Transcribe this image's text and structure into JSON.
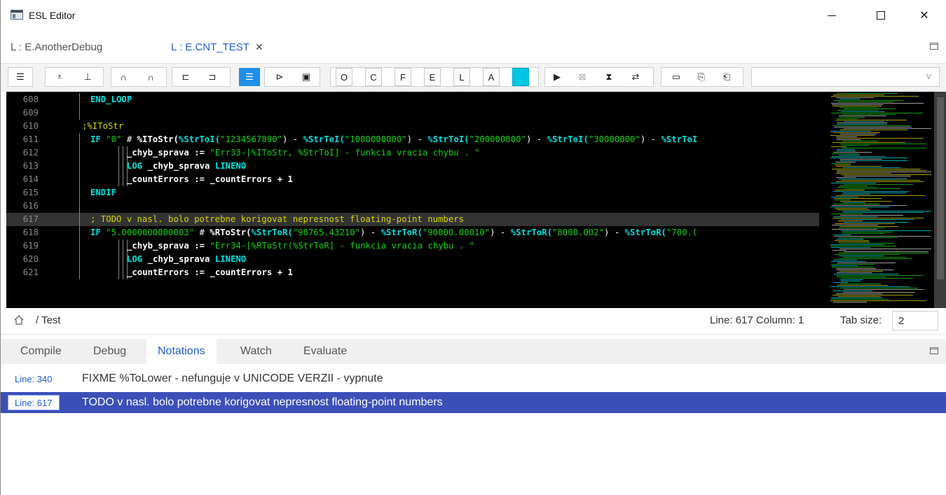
{
  "window": {
    "title": "ESL Editor"
  },
  "file_tabs": [
    {
      "label": "L : E.AnotherDebug",
      "active": false
    },
    {
      "label": "L : E.CNT_TEST",
      "active": true,
      "close": "✕"
    }
  ],
  "toolbar": {
    "icons": [
      "indent-icon",
      "check-icon",
      "cursor-down-icon",
      "undo-icon",
      "redo-icon",
      "bracket-left-icon",
      "bracket-right-icon",
      "list-icon",
      "open-folder-icon",
      "save-icon",
      "o-icon",
      "c-icon",
      "f-icon",
      "e-icon",
      "l-icon",
      "a-icon",
      "square-icon",
      "play-icon",
      "stop-icon",
      "hourglass-icon",
      "swap-icon",
      "window-icon",
      "clipboard-icon",
      "paste-icon"
    ],
    "labels": {
      "o": "O",
      "c": "C",
      "f": "F",
      "e": "E",
      "l": "L",
      "a": "A"
    },
    "combo_value": ""
  },
  "editor": {
    "highlight_color": "#333333",
    "lines": [
      {
        "n": "608",
        "indent": 1,
        "tokens": [
          {
            "t": "END_LOOP",
            "c": "#00e0e0"
          }
        ]
      },
      {
        "n": "609",
        "indent": 1,
        "tokens": []
      },
      {
        "n": "610",
        "indent": 0,
        "tokens": [
          {
            "t": ";%IToStr",
            "c": "#d6d600"
          }
        ]
      },
      {
        "n": "611",
        "indent": 1,
        "tokens": [
          {
            "t": "IF ",
            "c": "#00e0e0"
          },
          {
            "t": "\"0\"",
            "c": "#14d414"
          },
          {
            "t": " # ",
            "c": "#ffffff"
          },
          {
            "t": "%IToStr(",
            "c": "#ffffff"
          },
          {
            "t": "%StrToI(",
            "c": "#00e0e0"
          },
          {
            "t": "\"1234567890\"",
            "c": "#14d414"
          },
          {
            "t": ") - ",
            "c": "#ffffff"
          },
          {
            "t": "%StrToI(",
            "c": "#00e0e0"
          },
          {
            "t": "\"1000000000\"",
            "c": "#14d414"
          },
          {
            "t": ") - ",
            "c": "#ffffff"
          },
          {
            "t": "%StrToI(",
            "c": "#00e0e0"
          },
          {
            "t": "\"200000000\"",
            "c": "#14d414"
          },
          {
            "t": ") - ",
            "c": "#ffffff"
          },
          {
            "t": "%StrToI(",
            "c": "#00e0e0"
          },
          {
            "t": "\"30000000\"",
            "c": "#14d414"
          },
          {
            "t": ") - ",
            "c": "#ffffff"
          },
          {
            "t": "%StrToI",
            "c": "#00e0e0"
          }
        ]
      },
      {
        "n": "612",
        "indent": 4,
        "tokens": [
          {
            "t": "_chyb_sprava := ",
            "c": "#ffffff"
          },
          {
            "t": "\"Err33-[%IToStr, %StrToI] - funkcia vracia chybu . \"",
            "c": "#14d414"
          }
        ]
      },
      {
        "n": "613",
        "indent": 4,
        "tokens": [
          {
            "t": "LOG ",
            "c": "#00e0e0"
          },
          {
            "t": "_chyb_sprava ",
            "c": "#ffffff"
          },
          {
            "t": "LINENO",
            "c": "#00e0e0"
          }
        ]
      },
      {
        "n": "614",
        "indent": 4,
        "tokens": [
          {
            "t": "_countErrors := _countErrors + 1",
            "c": "#ffffff"
          }
        ]
      },
      {
        "n": "615",
        "indent": 1,
        "tokens": [
          {
            "t": "ENDIF",
            "c": "#00e0e0"
          }
        ]
      },
      {
        "n": "616",
        "indent": 1,
        "tokens": []
      },
      {
        "n": "617",
        "indent": 1,
        "highlight": true,
        "tokens": [
          {
            "t": "; TODO v nasl. bolo potrebne korigovat nepresnost floating-point numbers",
            "c": "#d6d600"
          }
        ]
      },
      {
        "n": "618",
        "indent": 1,
        "tokens": [
          {
            "t": "IF ",
            "c": "#00e0e0"
          },
          {
            "t": "\"5.0000000000003\"",
            "c": "#14d414"
          },
          {
            "t": " # ",
            "c": "#ffffff"
          },
          {
            "t": "%RToStr(",
            "c": "#ffffff"
          },
          {
            "t": "%StrToR(",
            "c": "#00e0e0"
          },
          {
            "t": "\"98765.43210\"",
            "c": "#14d414"
          },
          {
            "t": ") - ",
            "c": "#ffffff"
          },
          {
            "t": "%StrToR(",
            "c": "#00e0e0"
          },
          {
            "t": "\"90000.00010\"",
            "c": "#14d414"
          },
          {
            "t": ") - ",
            "c": "#ffffff"
          },
          {
            "t": "%StrToR(",
            "c": "#00e0e0"
          },
          {
            "t": "\"8000.002\"",
            "c": "#14d414"
          },
          {
            "t": ") - ",
            "c": "#ffffff"
          },
          {
            "t": "%StrToR(",
            "c": "#00e0e0"
          },
          {
            "t": "\"700.(",
            "c": "#14d414"
          }
        ]
      },
      {
        "n": "619",
        "indent": 4,
        "tokens": [
          {
            "t": "_chyb_sprava := ",
            "c": "#ffffff"
          },
          {
            "t": "\"Err34-[%RToStr(%StrToR] - funkcia vracia chybu . \"",
            "c": "#14d414"
          }
        ]
      },
      {
        "n": "620",
        "indent": 4,
        "tokens": [
          {
            "t": "LOG ",
            "c": "#00e0e0"
          },
          {
            "t": "_chyb_sprava ",
            "c": "#ffffff"
          },
          {
            "t": "LINENO",
            "c": "#00e0e0"
          }
        ]
      },
      {
        "n": "621",
        "indent": 4,
        "tokens": [
          {
            "t": "_countErrors := _countErrors + 1",
            "c": "#ffffff"
          }
        ]
      }
    ]
  },
  "status": {
    "breadcrumb": "/ Test",
    "line_col": "Line: 617 Column: 1",
    "tab_size_label": "Tab size:",
    "tab_size_value": "2"
  },
  "bottom_tabs": [
    {
      "label": "Compile",
      "active": false
    },
    {
      "label": "Debug",
      "active": false
    },
    {
      "label": "Notations",
      "active": true
    },
    {
      "label": "Watch",
      "active": false
    },
    {
      "label": "Evaluate",
      "active": false
    }
  ],
  "notations": [
    {
      "line": "Line: 340",
      "text": "FIXME %ToLower - nefunguje v UNICODE VERZII - vypnute",
      "selected": false
    },
    {
      "line": "Line: 617",
      "text": "TODO v nasl. bolo potrebne korigovat nepresnost floating-point numbers",
      "selected": true
    }
  ]
}
